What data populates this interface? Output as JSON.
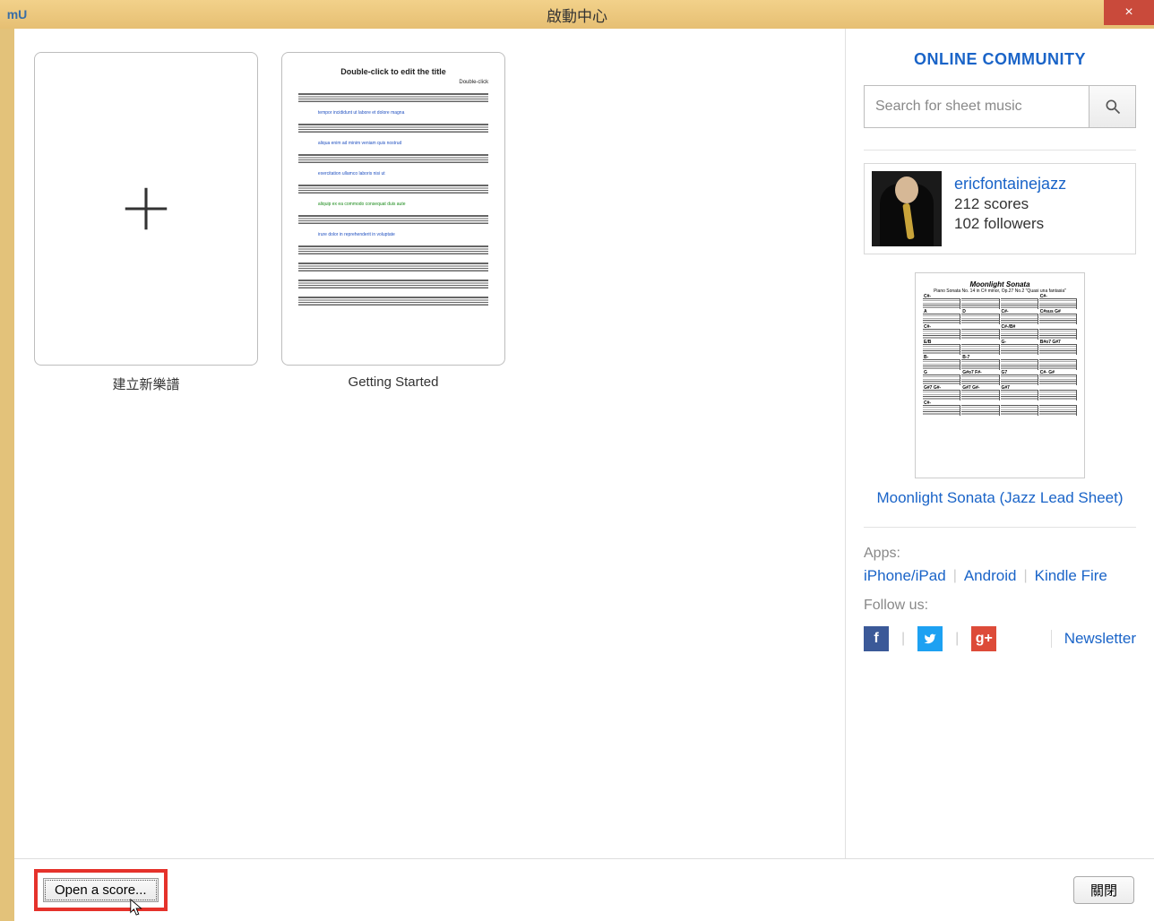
{
  "titlebar": {
    "app_icon_text": "mU",
    "title": "啟動中心",
    "close_label": "×"
  },
  "tiles": {
    "create_new_label": "建立新樂譜",
    "getting_started_label": "Getting Started",
    "preview_title": "Double-click to edit the title",
    "preview_subtitle": "Double-click"
  },
  "sidebar": {
    "community_title": "ONLINE COMMUNITY",
    "search_placeholder": "Search for sheet music",
    "user": {
      "name": "ericfontainejazz",
      "scores": "212 scores",
      "followers": "102 followers"
    },
    "featured": {
      "thumb_title": "Moonlight Sonata",
      "title": "Moonlight Sonata (Jazz Lead Sheet)"
    },
    "apps_label": "Apps:",
    "apps": {
      "iphone": "iPhone/iPad",
      "android": "Android",
      "kindle": "Kindle Fire"
    },
    "follow_label": "Follow us:",
    "newsletter": "Newsletter",
    "social": {
      "fb": "f",
      "tw": "t",
      "gp": "g+"
    }
  },
  "footer": {
    "open_score": "Open a score...",
    "close": "關閉"
  }
}
